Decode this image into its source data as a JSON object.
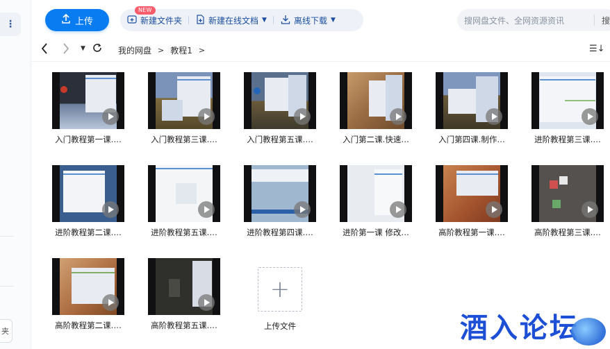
{
  "toolbar": {
    "upload_label": "上传",
    "new_folder_label": "新建文件夹",
    "new_online_doc_label": "新建在线文档",
    "new_badge": "NEW",
    "offline_download_label": "离线下载"
  },
  "search": {
    "placeholder": "搜网盘文件、全网资源资讯",
    "tail": "搜"
  },
  "leftbar": {
    "clip_text": "夹"
  },
  "breadcrumb": {
    "root": "我的网盘",
    "current": "教程1"
  },
  "files": [
    {
      "name": "入门教程第一课.…"
    },
    {
      "name": "入门教程第三课.…"
    },
    {
      "name": "入门教程第五课.…"
    },
    {
      "name": "入门第二课.快速…"
    },
    {
      "name": "入门第四课.制作…"
    },
    {
      "name": "进阶教程第三课.…"
    },
    {
      "name": "进阶教程第二课.…"
    },
    {
      "name": "进阶教程第五课.…"
    },
    {
      "name": "进阶教程第四课.…"
    },
    {
      "name": "进阶第一课 修改…"
    },
    {
      "name": "高阶教程第一课.…"
    },
    {
      "name": "高阶教程第三课.…"
    },
    {
      "name": "高阶教程第二课.…"
    },
    {
      "name": "高阶教程第五课.…"
    }
  ],
  "upload_tile_label": "上传文件",
  "watermark": "酒入论坛"
}
